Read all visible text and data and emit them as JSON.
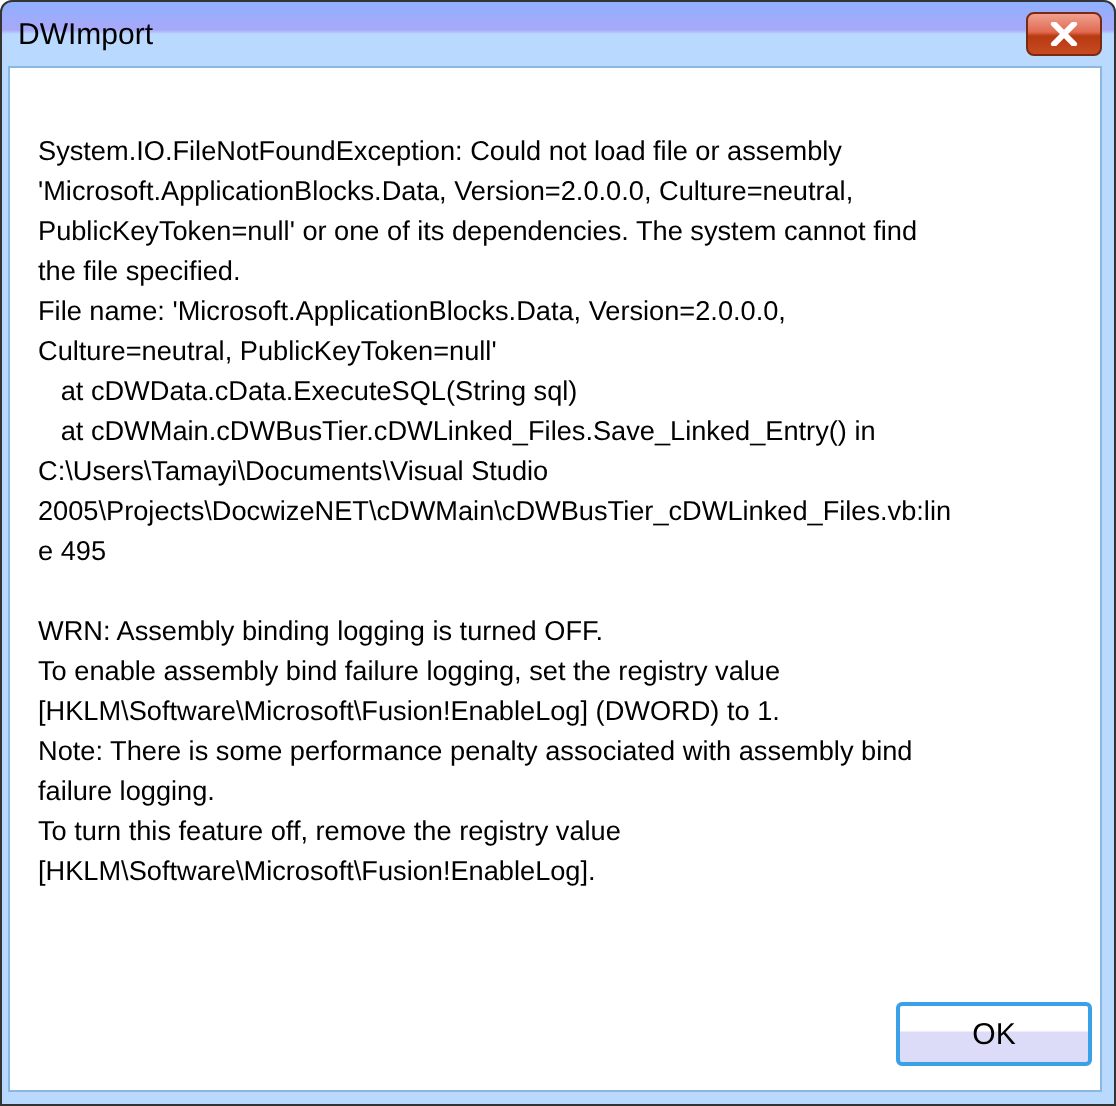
{
  "window": {
    "title": "DWImport"
  },
  "message": {
    "blocks": [
      [
        "System.IO.FileNotFoundException: Could not load file or assembly",
        "'Microsoft.ApplicationBlocks.Data, Version=2.0.0.0, Culture=neutral,",
        "PublicKeyToken=null' or one of its dependencies. The system cannot find",
        "the file specified.",
        "File name: 'Microsoft.ApplicationBlocks.Data, Version=2.0.0.0,",
        "Culture=neutral, PublicKeyToken=null'",
        "   at cDWData.cData.ExecuteSQL(String sql)",
        "   at cDWMain.cDWBusTier.cDWLinked_Files.Save_Linked_Entry() in",
        "C:\\Users\\Tamayi\\Documents\\Visual Studio",
        "2005\\Projects\\DocwizeNET\\cDWMain\\cDWBusTier_cDWLinked_Files.vb:lin",
        "e 495"
      ],
      [
        "WRN: Assembly binding logging is turned OFF.",
        "To enable assembly bind failure logging, set the registry value",
        "[HKLM\\Software\\Microsoft\\Fusion!EnableLog] (DWORD) to 1.",
        "Note: There is some performance penalty associated with assembly bind",
        "failure logging.",
        "To turn this feature off, remove the registry value",
        "[HKLM\\Software\\Microsoft\\Fusion!EnableLog]."
      ]
    ]
  },
  "buttons": [
    "OK"
  ]
}
